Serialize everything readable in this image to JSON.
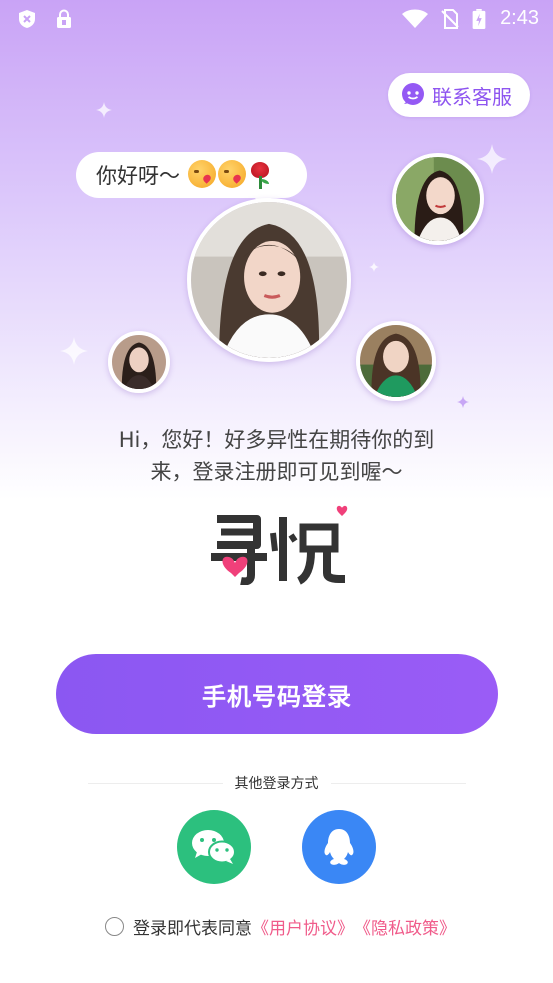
{
  "status_bar": {
    "time": "2:43",
    "icons": [
      "shield-x-icon",
      "lock-icon",
      "wifi-icon",
      "no-sim-icon",
      "battery-charging-icon"
    ]
  },
  "support": {
    "label": "联系客服",
    "icon": "chat-bubble-icon"
  },
  "bubble": {
    "text": "你好呀～",
    "emoji": [
      "kissing-face-emoji",
      "kissing-face-emoji",
      "rose-emoji"
    ]
  },
  "intro": {
    "line1": "Hi，您好！好多异性在期待你的到",
    "line2": "来，登录注册即可见到喔～"
  },
  "logo": {
    "text": "寻悦"
  },
  "phone_login": {
    "label": "手机号码登录"
  },
  "other_login": {
    "label": "其他登录方式",
    "options": [
      "wechat-icon",
      "qq-icon"
    ]
  },
  "agreement": {
    "prefix": "登录即代表同意",
    "user_agreement": "《用户协议》",
    "privacy_policy": "《隐私政策》"
  },
  "colors": {
    "accent": "#9459f4",
    "wechat": "#2cc07e",
    "qq": "#3a87f5",
    "link": "#f05b8a"
  }
}
